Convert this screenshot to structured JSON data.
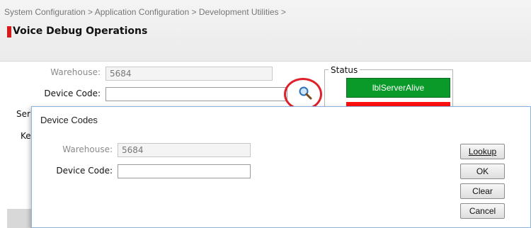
{
  "header": {
    "breadcrumb": "System Configuration > Application Configuration > Development Utilities >",
    "title": "Voice Debug Operations",
    "accent_color": "#d61b1b"
  },
  "form": {
    "warehouse_label": "Warehouse:",
    "warehouse_value": "5684",
    "device_code_label": "Device Code:",
    "device_code_value": "",
    "lookup_icon": "search-icon",
    "partial_label_1": "Ser",
    "partial_label_2": "Ke"
  },
  "status": {
    "legend": "Status",
    "server_alive_text": "lblServerAlive",
    "alive_color": "#0a9a2a",
    "error_color": "#ff1010"
  },
  "dialog": {
    "title": "Device Codes",
    "warehouse_label": "Warehouse:",
    "warehouse_value": "5684",
    "device_code_label": "Device Code:",
    "device_code_value": "",
    "buttons": {
      "lookup": "Lookup",
      "ok": "OK",
      "clear": "Clear",
      "cancel": "Cancel"
    }
  }
}
